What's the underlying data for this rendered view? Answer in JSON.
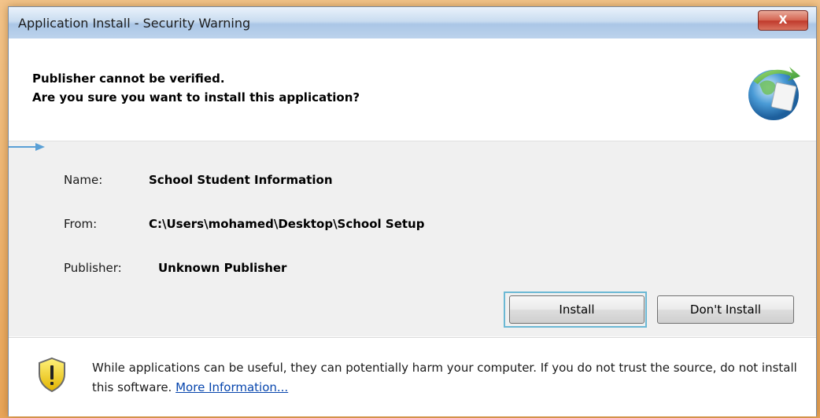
{
  "window": {
    "title": "Application Install - Security Warning",
    "close_label": "X"
  },
  "header": {
    "line1": "Publisher cannot be verified.",
    "line2": "Are you sure you want to install this application?"
  },
  "details": {
    "name_label": "Name:",
    "name_value": "School  Student Information",
    "from_label": "From:",
    "from_value": "C:\\Users\\mohamed\\Desktop\\School Setup",
    "publisher_label": "Publisher:",
    "publisher_value": "Unknown Publisher"
  },
  "buttons": {
    "install": "Install",
    "dont_install": "Don't Install"
  },
  "footer": {
    "warning_text": "While applications can be useful, they can potentially harm your computer. If you do not trust the source, do not install this software.",
    "link_text": "More Information..."
  },
  "colors": {
    "frame_orange": "#e9a558",
    "titlebar_blue": "#c9dcf0",
    "focus_ring": "#6bb8d4",
    "link_blue": "#0645ad",
    "arrow_blue": "#5aa0d6"
  },
  "icons": {
    "globe": "install-globe-icon",
    "shield": "warning-shield-icon",
    "arrow": "arrow-right-icon"
  }
}
